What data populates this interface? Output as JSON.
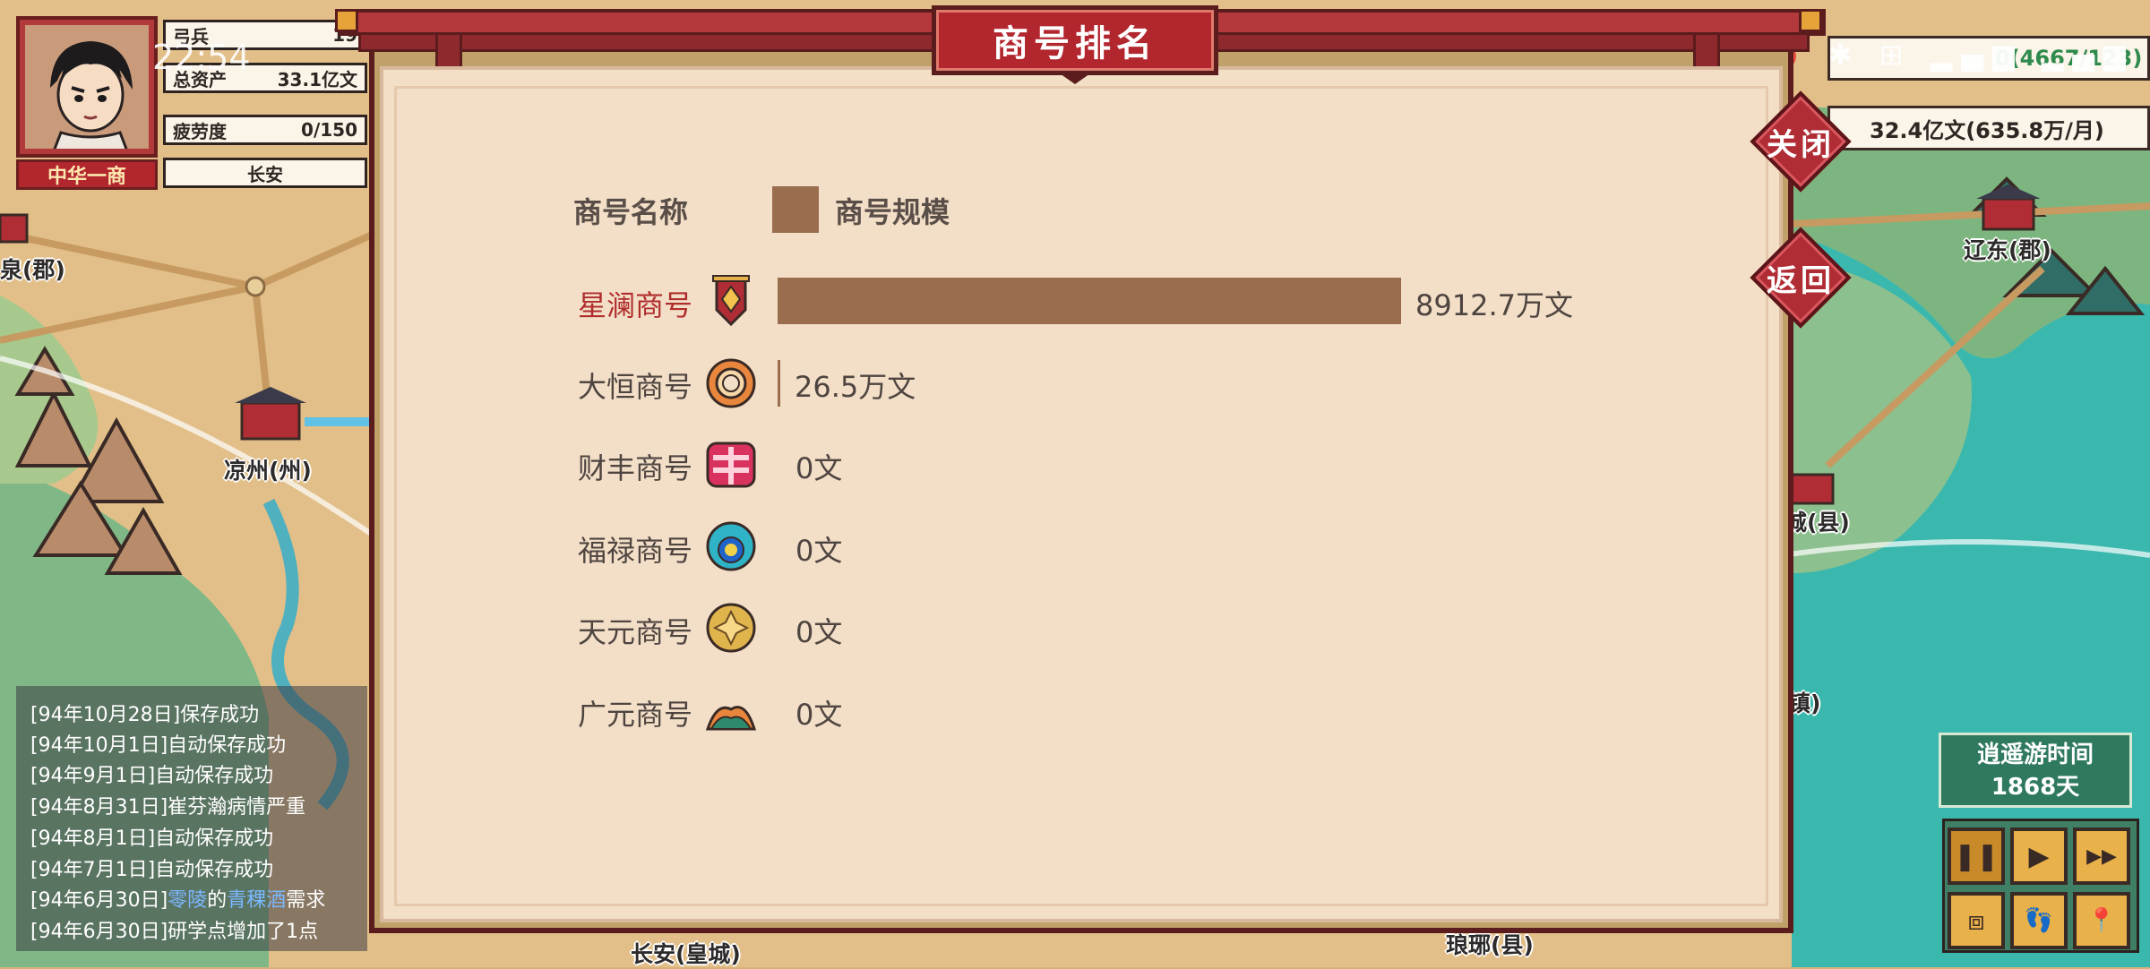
{
  "status_bar": {
    "time": "22:54",
    "right_icons": "👁 ⏰ ✱ ⊞ ▂▄▆ ▂▄▆",
    "battery": "0.4667"
  },
  "player": {
    "name": "中华一商",
    "stats": [
      {
        "label": "弓兵",
        "value": "19"
      },
      {
        "label": "总资产",
        "value": "33.1亿文"
      },
      {
        "label": "疲劳度",
        "value": "0/150"
      }
    ],
    "location": "长安"
  },
  "top_right": {
    "bar1_value": "0(4667/123)",
    "bar2_value": "32.4亿文(635.8万/月)"
  },
  "buttons": {
    "close": "关闭",
    "back": "返回"
  },
  "dialog": {
    "title": "商号排名",
    "legend_name": "商号名称",
    "legend_size": "商号规模"
  },
  "chart_data": {
    "type": "bar",
    "orientation": "horizontal",
    "categories": [
      "星澜商号",
      "大恒商号",
      "财丰商号",
      "福禄商号",
      "天元商号",
      "广元商号"
    ],
    "values": [
      8912.7,
      26.5,
      0,
      0,
      0,
      0
    ],
    "value_labels": [
      "8912.7万文",
      "26.5万文",
      "0文",
      "0文",
      "0文",
      "0文"
    ],
    "unit": "万文",
    "series": [
      {
        "name": "商号规模",
        "values": [
          8912.7,
          26.5,
          0,
          0,
          0,
          0
        ]
      }
    ],
    "bar_color": "#9a6d4f"
  },
  "map_labels": {
    "liangzhou": "凉州(州)",
    "liaodong": "辽东(郡)",
    "left_edge": "泉(郡)",
    "county": "城(县)",
    "town": "镇)",
    "changan": "长安(皇城)",
    "langye": "琅琊(县)"
  },
  "log": [
    {
      "prefix": "[94年10月28日]保存成功"
    },
    {
      "prefix": "[94年10月1日]自动保存成功"
    },
    {
      "prefix": "[94年9月1日]自动保存成功"
    },
    {
      "prefix": "[94年8月31日]崔芬瀚病情严重"
    },
    {
      "prefix": "[94年8月1日]自动保存成功"
    },
    {
      "prefix": "[94年7月1日]自动保存成功"
    },
    {
      "prefix": "[94年6月30日]",
      "place": "零陵",
      "mid": "的",
      "item": "青稞酒",
      "suffix": "需求"
    },
    {
      "prefix": "[94年6月30日]研学点增加了1点"
    }
  ],
  "travel": {
    "label": "逍遥游时间",
    "days": "1868天"
  },
  "controls": {
    "pause": "❚❚",
    "play": "▶",
    "fast": "▶▶",
    "box": "⧈",
    "walk": "👣",
    "pin": "📍"
  }
}
